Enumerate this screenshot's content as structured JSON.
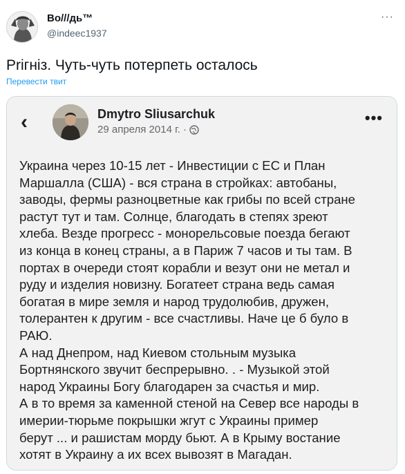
{
  "tweet": {
    "author_name": "Во///дь™",
    "author_handle": "@indeec1937",
    "text": "Prігніз. Чуть-чуть потерпеть осталось",
    "translate_label": "Перевести твит",
    "more_label": "···"
  },
  "embed": {
    "back_label": "‹",
    "author_name": "Dmytro Sliusarchuk",
    "date": "29 апреля 2014 г. ·",
    "more_label": "•••",
    "body": "Украина через 10-15 лет - Инвестиции с ЕС и План\nМаршалла (США) - вся страна в стройках: автобаны,\nзаводы, фермы разноцветные как грибы по всей стране\nрастут тут и там. Солнце, благодать в степях зреют\nхлеба. Везде прогресс - монорельсовые поезда бегают\nиз конца в конец страны, а в Париж 7 часов и ты там. В\nпортах в очереди стоят корабли и везут они не метал и\nруду и изделия новизну. Богатеет страна ведь самая\nбогатая в мире земля и народ трудолюбив, дружен,\nтолерантен к другим - все счастливы. Наче це б було в\nРАЮ.\nА над Днепром, над Киевом стольным музыка\nБортнянского звучит беспрерывно. . - Музыкой этой\nнарод Украины Богу благодарен за счастья и мир.\nА в то время за каменной стеной на Север все народы в\nимерии-тюрьме покрышки жгут с Украины пример\nберут ... и рашистам морду бьют. А в Крыму востание\nхотят в Украину а их всех вывозят в Магадан."
  },
  "icons": {
    "avatar": "avatar-portrait",
    "globe": "globe-icon",
    "more": "more-dots-icon",
    "back": "chevron-left-icon"
  },
  "colors": {
    "link": "#1d9bf0",
    "handle": "#536471",
    "fb_secondary": "#65676b"
  }
}
